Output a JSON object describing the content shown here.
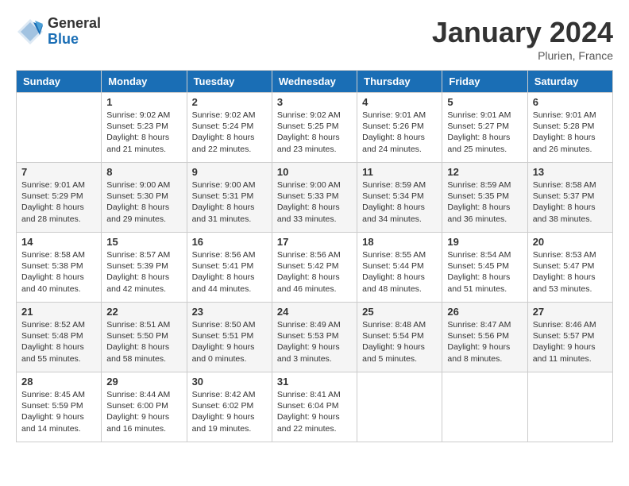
{
  "logo": {
    "general": "General",
    "blue": "Blue"
  },
  "title": "January 2024",
  "location": "Plurien, France",
  "days_of_week": [
    "Sunday",
    "Monday",
    "Tuesday",
    "Wednesday",
    "Thursday",
    "Friday",
    "Saturday"
  ],
  "weeks": [
    [
      {
        "day": "",
        "info": ""
      },
      {
        "day": "1",
        "info": "Sunrise: 9:02 AM\nSunset: 5:23 PM\nDaylight: 8 hours\nand 21 minutes."
      },
      {
        "day": "2",
        "info": "Sunrise: 9:02 AM\nSunset: 5:24 PM\nDaylight: 8 hours\nand 22 minutes."
      },
      {
        "day": "3",
        "info": "Sunrise: 9:02 AM\nSunset: 5:25 PM\nDaylight: 8 hours\nand 23 minutes."
      },
      {
        "day": "4",
        "info": "Sunrise: 9:01 AM\nSunset: 5:26 PM\nDaylight: 8 hours\nand 24 minutes."
      },
      {
        "day": "5",
        "info": "Sunrise: 9:01 AM\nSunset: 5:27 PM\nDaylight: 8 hours\nand 25 minutes."
      },
      {
        "day": "6",
        "info": "Sunrise: 9:01 AM\nSunset: 5:28 PM\nDaylight: 8 hours\nand 26 minutes."
      }
    ],
    [
      {
        "day": "7",
        "info": "Sunrise: 9:01 AM\nSunset: 5:29 PM\nDaylight: 8 hours\nand 28 minutes."
      },
      {
        "day": "8",
        "info": "Sunrise: 9:00 AM\nSunset: 5:30 PM\nDaylight: 8 hours\nand 29 minutes."
      },
      {
        "day": "9",
        "info": "Sunrise: 9:00 AM\nSunset: 5:31 PM\nDaylight: 8 hours\nand 31 minutes."
      },
      {
        "day": "10",
        "info": "Sunrise: 9:00 AM\nSunset: 5:33 PM\nDaylight: 8 hours\nand 33 minutes."
      },
      {
        "day": "11",
        "info": "Sunrise: 8:59 AM\nSunset: 5:34 PM\nDaylight: 8 hours\nand 34 minutes."
      },
      {
        "day": "12",
        "info": "Sunrise: 8:59 AM\nSunset: 5:35 PM\nDaylight: 8 hours\nand 36 minutes."
      },
      {
        "day": "13",
        "info": "Sunrise: 8:58 AM\nSunset: 5:37 PM\nDaylight: 8 hours\nand 38 minutes."
      }
    ],
    [
      {
        "day": "14",
        "info": "Sunrise: 8:58 AM\nSunset: 5:38 PM\nDaylight: 8 hours\nand 40 minutes."
      },
      {
        "day": "15",
        "info": "Sunrise: 8:57 AM\nSunset: 5:39 PM\nDaylight: 8 hours\nand 42 minutes."
      },
      {
        "day": "16",
        "info": "Sunrise: 8:56 AM\nSunset: 5:41 PM\nDaylight: 8 hours\nand 44 minutes."
      },
      {
        "day": "17",
        "info": "Sunrise: 8:56 AM\nSunset: 5:42 PM\nDaylight: 8 hours\nand 46 minutes."
      },
      {
        "day": "18",
        "info": "Sunrise: 8:55 AM\nSunset: 5:44 PM\nDaylight: 8 hours\nand 48 minutes."
      },
      {
        "day": "19",
        "info": "Sunrise: 8:54 AM\nSunset: 5:45 PM\nDaylight: 8 hours\nand 51 minutes."
      },
      {
        "day": "20",
        "info": "Sunrise: 8:53 AM\nSunset: 5:47 PM\nDaylight: 8 hours\nand 53 minutes."
      }
    ],
    [
      {
        "day": "21",
        "info": "Sunrise: 8:52 AM\nSunset: 5:48 PM\nDaylight: 8 hours\nand 55 minutes."
      },
      {
        "day": "22",
        "info": "Sunrise: 8:51 AM\nSunset: 5:50 PM\nDaylight: 8 hours\nand 58 minutes."
      },
      {
        "day": "23",
        "info": "Sunrise: 8:50 AM\nSunset: 5:51 PM\nDaylight: 9 hours\nand 0 minutes."
      },
      {
        "day": "24",
        "info": "Sunrise: 8:49 AM\nSunset: 5:53 PM\nDaylight: 9 hours\nand 3 minutes."
      },
      {
        "day": "25",
        "info": "Sunrise: 8:48 AM\nSunset: 5:54 PM\nDaylight: 9 hours\nand 5 minutes."
      },
      {
        "day": "26",
        "info": "Sunrise: 8:47 AM\nSunset: 5:56 PM\nDaylight: 9 hours\nand 8 minutes."
      },
      {
        "day": "27",
        "info": "Sunrise: 8:46 AM\nSunset: 5:57 PM\nDaylight: 9 hours\nand 11 minutes."
      }
    ],
    [
      {
        "day": "28",
        "info": "Sunrise: 8:45 AM\nSunset: 5:59 PM\nDaylight: 9 hours\nand 14 minutes."
      },
      {
        "day": "29",
        "info": "Sunrise: 8:44 AM\nSunset: 6:00 PM\nDaylight: 9 hours\nand 16 minutes."
      },
      {
        "day": "30",
        "info": "Sunrise: 8:42 AM\nSunset: 6:02 PM\nDaylight: 9 hours\nand 19 minutes."
      },
      {
        "day": "31",
        "info": "Sunrise: 8:41 AM\nSunset: 6:04 PM\nDaylight: 9 hours\nand 22 minutes."
      },
      {
        "day": "",
        "info": ""
      },
      {
        "day": "",
        "info": ""
      },
      {
        "day": "",
        "info": ""
      }
    ]
  ]
}
